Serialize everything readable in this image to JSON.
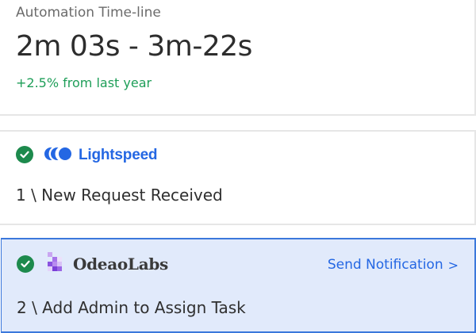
{
  "timeline": {
    "title": "Automation Time-line",
    "value": "2m 03s - 3m-22s",
    "change": "+2.5% from last year",
    "change_color": "#1e9e58"
  },
  "steps": [
    {
      "status_icon": "check-circle-icon",
      "brand_icon": "lightspeed-logo-icon",
      "brand_name": "Lightspeed",
      "brand_color": "#2467e3",
      "label": "1 \\ New Request Received"
    },
    {
      "status_icon": "check-circle-icon",
      "brand_icon": "odeaolabs-logo-icon",
      "brand_name": "OdeaoLabs",
      "label": "2 \\ Add Admin to Assign Task",
      "action_label": "Send Notification",
      "action_icon": "chevron-right-icon",
      "highlighted": true
    }
  ],
  "colors": {
    "accent": "#2467e3",
    "success": "#1d8a4d",
    "highlight_bg": "#e1eafb",
    "highlight_border": "#3b78dc"
  }
}
